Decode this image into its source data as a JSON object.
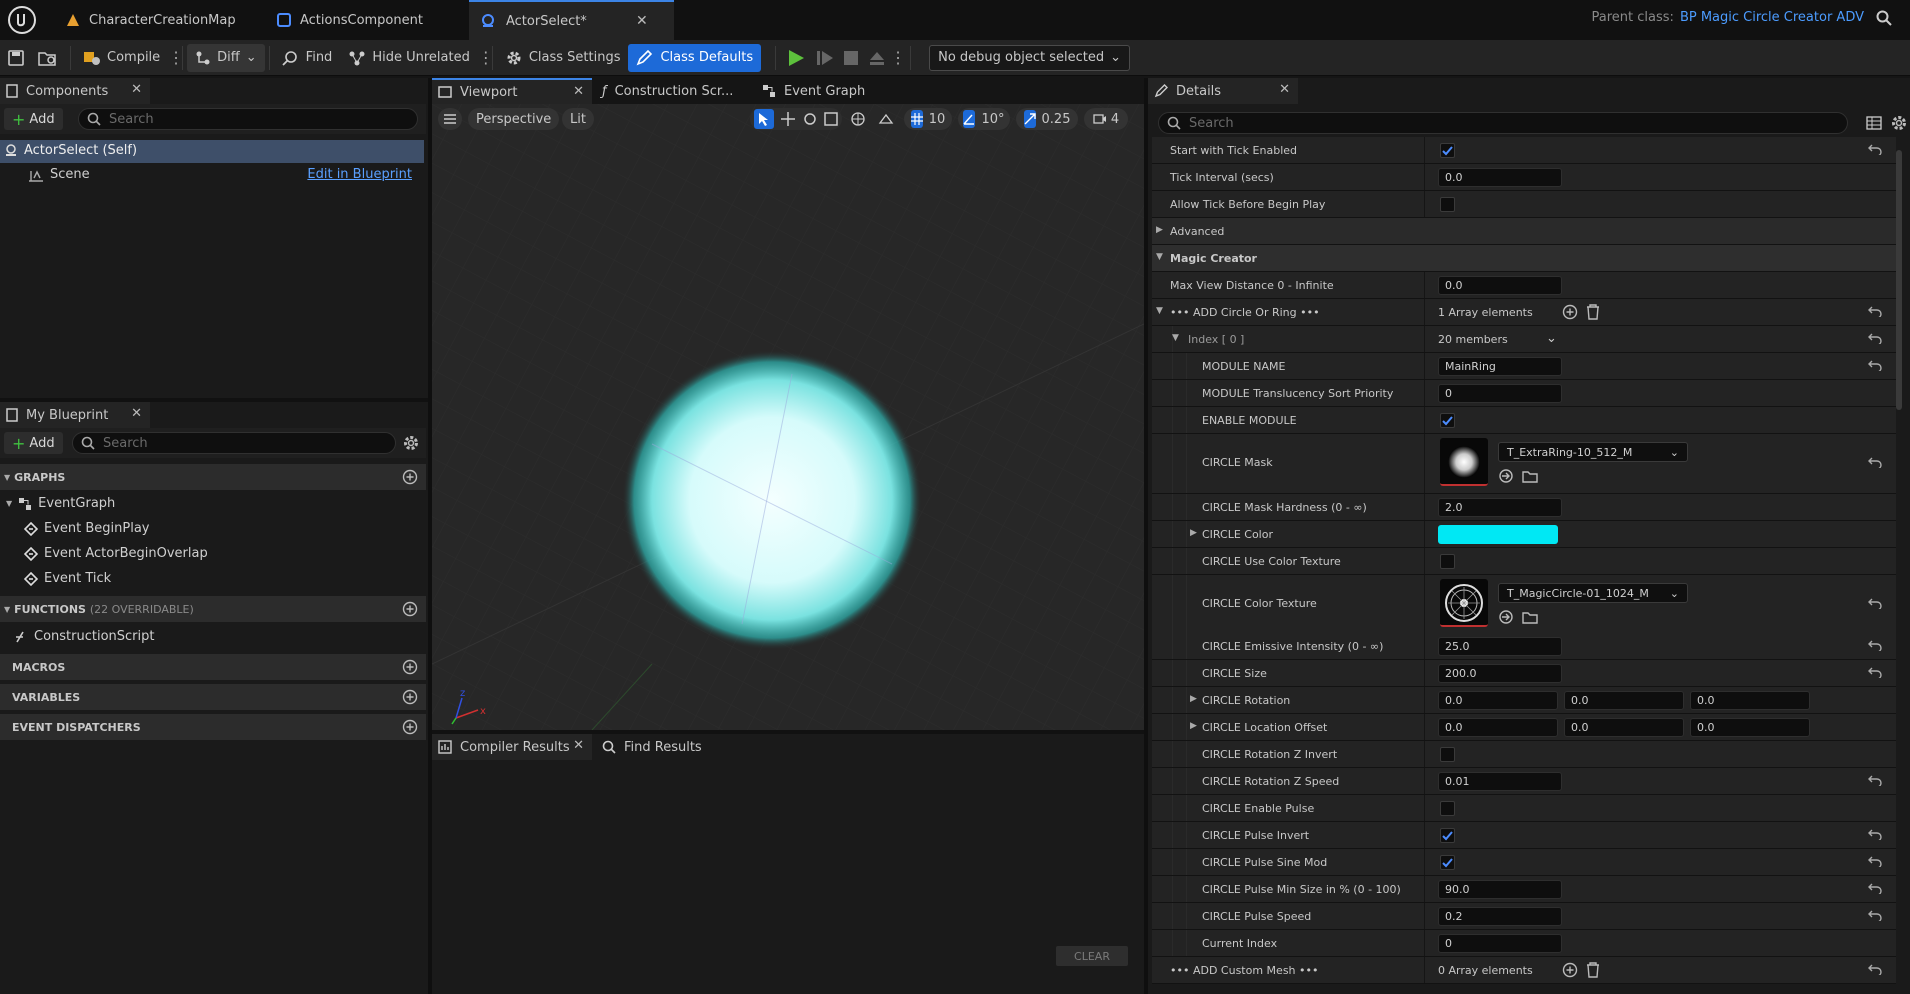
{
  "title_bar": {
    "tabs": [
      {
        "label": "CharacterCreationMap",
        "icon": "level-icon"
      },
      {
        "label": "ActionsComponent",
        "icon": "component-blueprint-icon"
      },
      {
        "label": "ActorSelect*",
        "icon": "actor-blueprint-icon",
        "active": true
      }
    ],
    "parent_class_label": "Parent class:",
    "parent_class_value": "BP Magic Circle Creator ADV"
  },
  "toolbar": {
    "compile": "Compile",
    "diff": "Diff",
    "find": "Find",
    "hide_unrelated": "Hide Unrelated",
    "class_settings": "Class Settings",
    "class_defaults": "Class Defaults",
    "debug_object": "No debug object selected"
  },
  "components_panel": {
    "tab": "Components",
    "add": "Add",
    "search_placeholder": "Search",
    "root": "ActorSelect (Self)",
    "child": "Scene",
    "edit_link": "Edit in Blueprint"
  },
  "my_blueprint": {
    "tab": "My Blueprint",
    "add": "Add",
    "search_placeholder": "Search",
    "graphs_label": "GRAPHS",
    "event_graph": "EventGraph",
    "events": [
      "Event BeginPlay",
      "Event ActorBeginOverlap",
      "Event Tick"
    ],
    "functions_label": "FUNCTIONS",
    "functions_count": "(22 OVERRIDABLE)",
    "construction_script": "ConstructionScript",
    "macros_label": "MACROS",
    "variables_label": "VARIABLES",
    "dispatchers_label": "EVENT DISPATCHERS"
  },
  "editor_tabs": {
    "viewport": "Viewport",
    "construction": "Construction Scr...",
    "event_graph": "Event Graph"
  },
  "viewport": {
    "perspective": "Perspective",
    "lit": "Lit",
    "grid_snap": "10",
    "rot_snap": "10°",
    "scale_snap": "0.25",
    "camera_speed": "4"
  },
  "bottom_panel": {
    "compiler_results": "Compiler Results",
    "find_results": "Find Results",
    "clear": "CLEAR"
  },
  "details": {
    "tab": "Details",
    "search_placeholder": "Search",
    "rows": {
      "tick_enabled": "Start with Tick Enabled",
      "tick_interval": "Tick Interval (secs)",
      "tick_interval_val": "0.0",
      "allow_tick": "Allow Tick Before Begin Play",
      "advanced": "Advanced",
      "magic_creator": "Magic Creator",
      "max_view": "Max View Distance 0 - Infinite",
      "max_view_val": "0.0",
      "add_circle": "••• ADD Circle Or Ring •••",
      "add_circle_val": "1 Array elements",
      "index": "Index [ 0 ]",
      "index_val": "20 members",
      "module_name": "MODULE NAME",
      "module_name_val": "MainRing",
      "module_sort": "MODULE Translucency Sort Priority",
      "module_sort_val": "0",
      "enable_module": "ENABLE MODULE",
      "circle_mask": "CIRCLE Mask",
      "circle_mask_val": "T_ExtraRing-10_512_M",
      "mask_hardness": "CIRCLE Mask Hardness (0 - ∞)",
      "mask_hardness_val": "2.0",
      "circle_color": "CIRCLE Color",
      "circle_color_hex": "#00e8f4",
      "use_color_tex": "CIRCLE Use Color Texture",
      "color_tex": "CIRCLE Color Texture",
      "color_tex_val": "T_MagicCircle-01_1024_M",
      "emissive": "CIRCLE Emissive Intensity (0 - ∞)",
      "emissive_val": "25.0",
      "size": "CIRCLE Size",
      "size_val": "200.0",
      "rotation": "CIRCLE Rotation",
      "rotation_val": [
        "0.0",
        "0.0",
        "0.0"
      ],
      "loc_offset": "CIRCLE Location Offset",
      "loc_offset_val": [
        "0.0",
        "0.0",
        "0.0"
      ],
      "rot_z_invert": "CIRCLE Rotation Z Invert",
      "rot_z_speed": "CIRCLE Rotation Z Speed",
      "rot_z_speed_val": "0.01",
      "enable_pulse": "CIRCLE Enable Pulse",
      "pulse_invert": "CIRCLE Pulse Invert",
      "pulse_sine": "CIRCLE Pulse Sine Mod",
      "pulse_min": "CIRCLE Pulse Min Size in %  (0 - 100)",
      "pulse_min_val": "90.0",
      "pulse_speed": "CIRCLE Pulse Speed",
      "pulse_speed_val": "0.2",
      "current_index": "Current Index",
      "current_index_val": "0",
      "add_mesh": "••• ADD Custom Mesh •••",
      "add_mesh_val": "0 Array elements"
    }
  }
}
